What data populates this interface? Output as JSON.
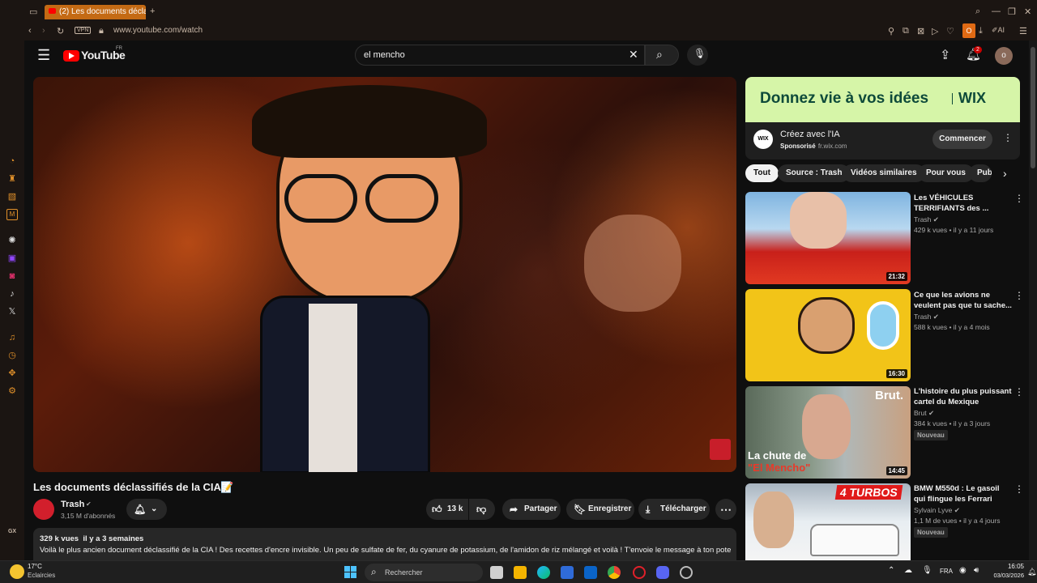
{
  "browser": {
    "tab_title": "(2) Les documents déclass",
    "url": "www.youtube.com/watch",
    "vpn_label": "VPN",
    "ai_label": "AI",
    "profile_initial": "O",
    "gx_label": "GX"
  },
  "youtube": {
    "logo_text": "YouTube",
    "region": "FR",
    "search_value": "el mencho",
    "notif_count": "2",
    "avatar_initial": "o",
    "video": {
      "title": "Les documents déclassifiés de la CIA",
      "channel": "Trash",
      "subscribers": "3,15 M d'abonnés",
      "likes": "13 k",
      "share": "Partager",
      "save": "Enregistrer",
      "download": "Télécharger",
      "views_date": "329 k vues  il y a 3 semaines",
      "description": "Voilà le plus ancien document déclassifié de la CIA ! Des recettes d'encre invisible. Un peu de sulfate de fer, du cyanure de potassium, de l'amidon de riz mélangé et voilà ! T'envoie le message à ton pote qui a"
    },
    "ad": {
      "banner_text": "Donnez vie à vos idées",
      "banner_brand": "WIX",
      "logo": "WIX",
      "title": "Créez avec l'IA",
      "sponsored": "Sponsorisé",
      "domain": "fr.wix.com",
      "cta": "Commencer"
    },
    "chips": [
      "Tout",
      "Source : Trash",
      "Vidéos similaires",
      "Pour vous",
      "Publ"
    ],
    "recommendations": [
      {
        "title": "Les VÉHICULES TERRIFIANTS des ...",
        "channel": "Trash",
        "meta": "429 k vues  •  il y a 11 jours",
        "duration": "21:32",
        "badge": ""
      },
      {
        "title": "Ce que les avions ne veulent pas que tu sache...",
        "channel": "Trash",
        "meta": "588 k vues  •  il y a 4 mois",
        "duration": "16:30",
        "badge": ""
      },
      {
        "title": "L'histoire du plus puissant cartel du Mexique",
        "channel": "Brut",
        "meta": "384 k vues  •  il y a 3 jours",
        "duration": "14:45",
        "badge": "Nouveau",
        "thumb_text_top": "Brut.",
        "thumb_text_line1": "La chute de",
        "thumb_text_line2": "\"El Mencho\""
      },
      {
        "title": "BMW M550d : Le gasoil qui flingue les Ferrari",
        "channel": "Sylvain Lyve",
        "meta": "1,1 M de vues  •  il y a 4 jours",
        "duration": "",
        "badge": "Nouveau",
        "thumb_text_top": "4 TURBOS"
      }
    ]
  },
  "taskbar": {
    "temp": "17°C",
    "weather": "Eclaircies",
    "search": "Rechercher",
    "lang": "FRA",
    "time": "16:05",
    "date": "03/03/2026"
  },
  "colors": {
    "accent": "#c46a14",
    "yt_red": "#ff0000",
    "bg": "#0f0f0f",
    "chip": "#272727",
    "wix_banner": "#d6f5a8"
  }
}
